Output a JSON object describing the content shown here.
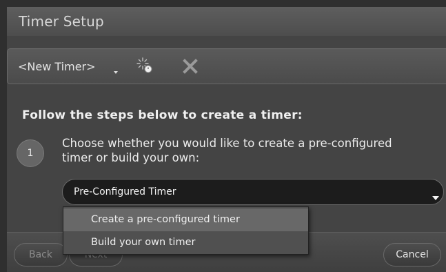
{
  "window": {
    "title": "Timer Setup"
  },
  "toolbar": {
    "timer_name": "<New Timer>",
    "icons": [
      "chevron-down-icon",
      "new-timer-icon",
      "delete-icon"
    ]
  },
  "main": {
    "instructions": "Follow the steps below to create a timer:",
    "step": {
      "number": "1",
      "text": "Choose whether you would like to create a pre-configured timer or build your own:"
    },
    "select": {
      "value": "Pre-Configured Timer",
      "options": [
        "Create a pre-configured timer",
        "Build your own timer"
      ],
      "highlighted_index": 0
    }
  },
  "footer": {
    "back_label": "Back",
    "next_label": "Next",
    "cancel_label": "Cancel"
  },
  "colors": {
    "background": "#2f2f2f",
    "panel": "#444444",
    "select_bg": "#1c1c1c",
    "menu_bg": "#505050",
    "menu_highlight": "#686868"
  }
}
